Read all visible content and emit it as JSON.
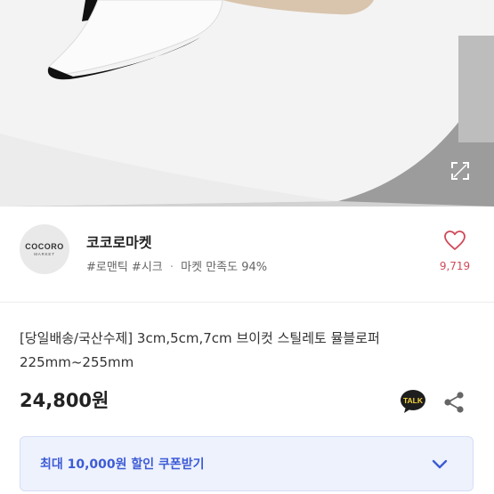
{
  "product_photo": {
    "alt": "product-photo",
    "expand_icon": "expand-icon"
  },
  "seller": {
    "logo_line1": "COCORO",
    "logo_line2": "MARKET",
    "name": "코코로마켓",
    "tags": [
      "#로맨틱",
      "#시크"
    ],
    "separator": "·",
    "satisfaction": "마켓 만족도 94%",
    "like_icon": "heart-icon",
    "like_count": "9,719"
  },
  "product": {
    "title": "[당일배송/국산수제] 3cm,5cm,7cm 브이컷 스틸레토 뮬블로퍼 225mm~255mm",
    "price": "24,800원",
    "talk_label": "TALK",
    "share_icon": "share-icon"
  },
  "coupon": {
    "label": "최대 10,000원 할인 쿠폰받기",
    "chevron_icon": "chevron-down-icon"
  },
  "colors": {
    "accent_blue": "#3d5bd6",
    "coupon_bg": "#eef2fd",
    "heart": "#d04a5a"
  }
}
